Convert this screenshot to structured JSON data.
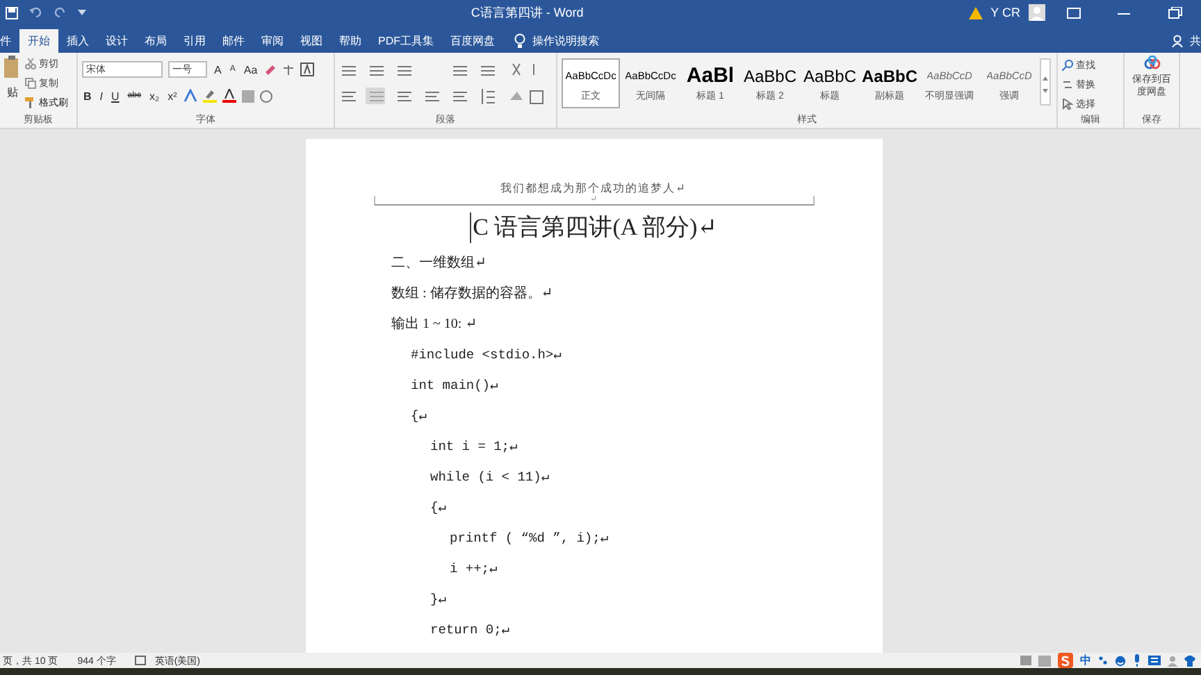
{
  "window": {
    "title": "C语言第四讲 - Word",
    "user": "Y CR"
  },
  "tabs": [
    {
      "label": "件",
      "selected": false
    },
    {
      "label": "开始",
      "selected": true
    },
    {
      "label": "插入",
      "selected": false
    },
    {
      "label": "设计",
      "selected": false
    },
    {
      "label": "布局",
      "selected": false
    },
    {
      "label": "引用",
      "selected": false
    },
    {
      "label": "邮件",
      "selected": false
    },
    {
      "label": "审阅",
      "selected": false
    },
    {
      "label": "视图",
      "selected": false
    },
    {
      "label": "帮助",
      "selected": false
    },
    {
      "label": "PDF工具集",
      "selected": false
    },
    {
      "label": "百度网盘",
      "selected": false
    }
  ],
  "tell_me": "操作说明搜索",
  "share": "共",
  "ribbon": {
    "clipboard": {
      "paste": "贴",
      "cut": "剪切",
      "copy": "复制",
      "format_painter": "格式刷",
      "label": "剪贴板"
    },
    "font": {
      "name": "宋体",
      "size": "一号",
      "row1": [
        "A",
        "A",
        "Aa"
      ],
      "row2": [
        "B",
        "I",
        "U",
        "abc",
        "x₂",
        "x²"
      ],
      "label": "字体"
    },
    "paragraph": {
      "label": "段落"
    },
    "styles": {
      "label": "样式",
      "items": [
        {
          "sample": "AaBbCcDc",
          "name": "正文",
          "kind": "normal",
          "selected": true
        },
        {
          "sample": "AaBbCcDc",
          "name": "无间隔",
          "kind": "normal",
          "selected": false
        },
        {
          "sample": "AaBl",
          "name": "标题 1",
          "kind": "large",
          "selected": false
        },
        {
          "sample": "AaBbC",
          "name": "标题 2",
          "kind": "medium",
          "selected": false
        },
        {
          "sample": "AaBbC",
          "name": "标题",
          "kind": "medium",
          "selected": false
        },
        {
          "sample": "AaBbC",
          "name": "副标题",
          "kind": "bold",
          "selected": false
        },
        {
          "sample": "AaBbCcD",
          "name": "不明显强调",
          "kind": "italic",
          "selected": false
        },
        {
          "sample": "AaBbCcD",
          "name": "强调",
          "kind": "italic",
          "selected": false
        }
      ]
    },
    "editing": {
      "find": "查找",
      "replace": "替换",
      "select": "选择",
      "label": "编辑"
    },
    "save": {
      "button": "保存到百度网盘",
      "label": "保存"
    }
  },
  "document": {
    "header": "我们都想成为那个成功的追梦人↵",
    "header_mark": "↵",
    "title": "C 语言第四讲(A 部分)↵",
    "paragraphs": [
      "二、一维数组↵",
      "数组 : 储存数据的容器。↵",
      "输出 1 ~ 10: ↵"
    ],
    "code": [
      {
        "text": "#include <stdio.h>↵"
      },
      {
        "text": "int main()↵"
      },
      {
        "text": "{↵",
        "children": [
          {
            "text": "int i = 1;↵"
          },
          {
            "text": "while (i < 11)↵"
          },
          {
            "text": "{↵",
            "children": [
              {
                "text": "printf ( “%d ”, i);↵"
              },
              {
                "text": "i ++;↵"
              }
            ]
          },
          {
            "text": "}↵"
          },
          {
            "text": "return 0;↵"
          }
        ]
      }
    ]
  },
  "status_bar": {
    "page": "页，共 10 页",
    "words": "944 个字",
    "language": "英语(美国)",
    "ime": "中"
  }
}
